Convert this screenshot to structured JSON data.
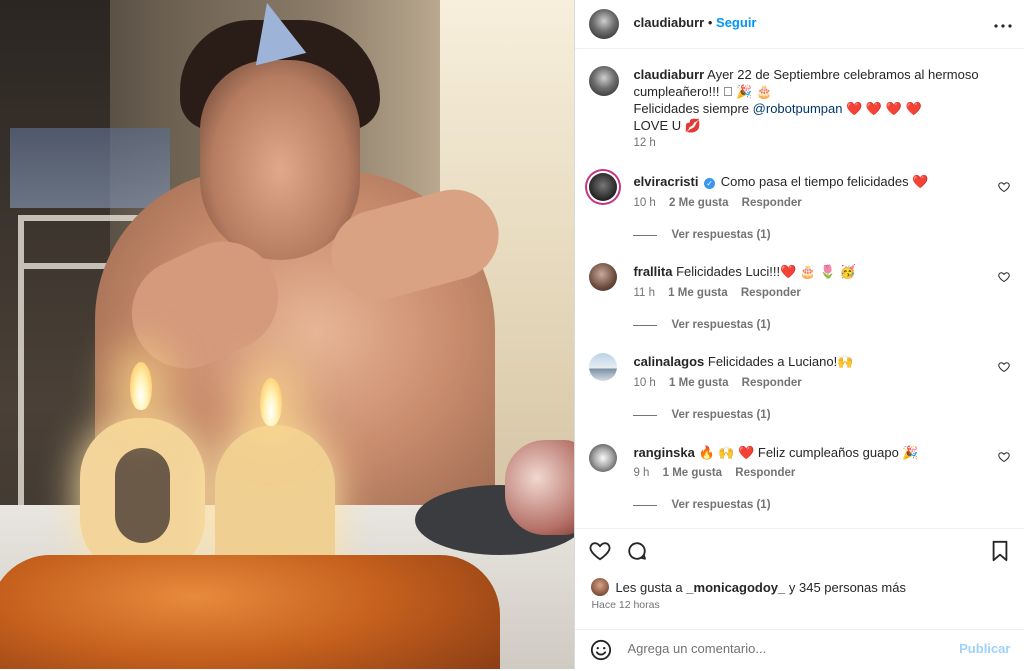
{
  "post": {
    "username": "claudiaburr",
    "follow_label": "Seguir",
    "more_label": "•••",
    "caption": {
      "username": "claudiaburr",
      "line1": "Ayer 22 de Septiembre celebramos al hermoso",
      "line2": "cumpleañero!!! 🏻 🎉 🎂",
      "line3_text": "Felicidades siempre",
      "line3_mention": "@robotpumpan",
      "line3_hearts": "❤️ ❤️ ❤️ ❤️",
      "line4": "LOVE U 💋",
      "time": "12 h"
    }
  },
  "comments": [
    {
      "username": "elviracristi",
      "verified": true,
      "text": "Como pasa el tiempo felicidades ❤️",
      "time": "10 h",
      "likes": "2 Me gusta",
      "reply_label": "Responder",
      "view_replies": "Ver respuestas (1)"
    },
    {
      "username": "frallita",
      "text": "Felicidades Luci!!!❤️ 🎂 🌷 🥳",
      "time": "11 h",
      "likes": "1 Me gusta",
      "reply_label": "Responder",
      "view_replies": "Ver respuestas (1)"
    },
    {
      "username": "calinalagos",
      "text": "Felicidades a Luciano!🙌",
      "time": "10 h",
      "likes": "1 Me gusta",
      "reply_label": "Responder",
      "view_replies": "Ver respuestas (1)"
    },
    {
      "username": "ranginska",
      "text": "🔥 🙌 ❤️ Feliz cumpleaños guapo 🎉",
      "time": "9 h",
      "likes": "1 Me gusta",
      "reply_label": "Responder",
      "view_replies": "Ver respuestas (1)"
    }
  ],
  "actions": {
    "likes_prefix": "Les gusta a",
    "likes_user": "_monicagodoy_",
    "likes_suffix": "y 345 personas más",
    "time": "Hace 12 horas",
    "comment_placeholder": "Agrega un comentario...",
    "publish_label": "Publicar"
  },
  "icons": {
    "like": "heart-icon",
    "comment": "comment-icon",
    "save": "bookmark-icon",
    "emoji": "smiley-icon",
    "comment_like": "heart-outline-icon"
  },
  "colors": {
    "link_blue": "#0095f6",
    "mention": "#00376b",
    "muted": "#737373",
    "publish_disabled": "#9fd2fa",
    "heart": "#ed4956"
  }
}
